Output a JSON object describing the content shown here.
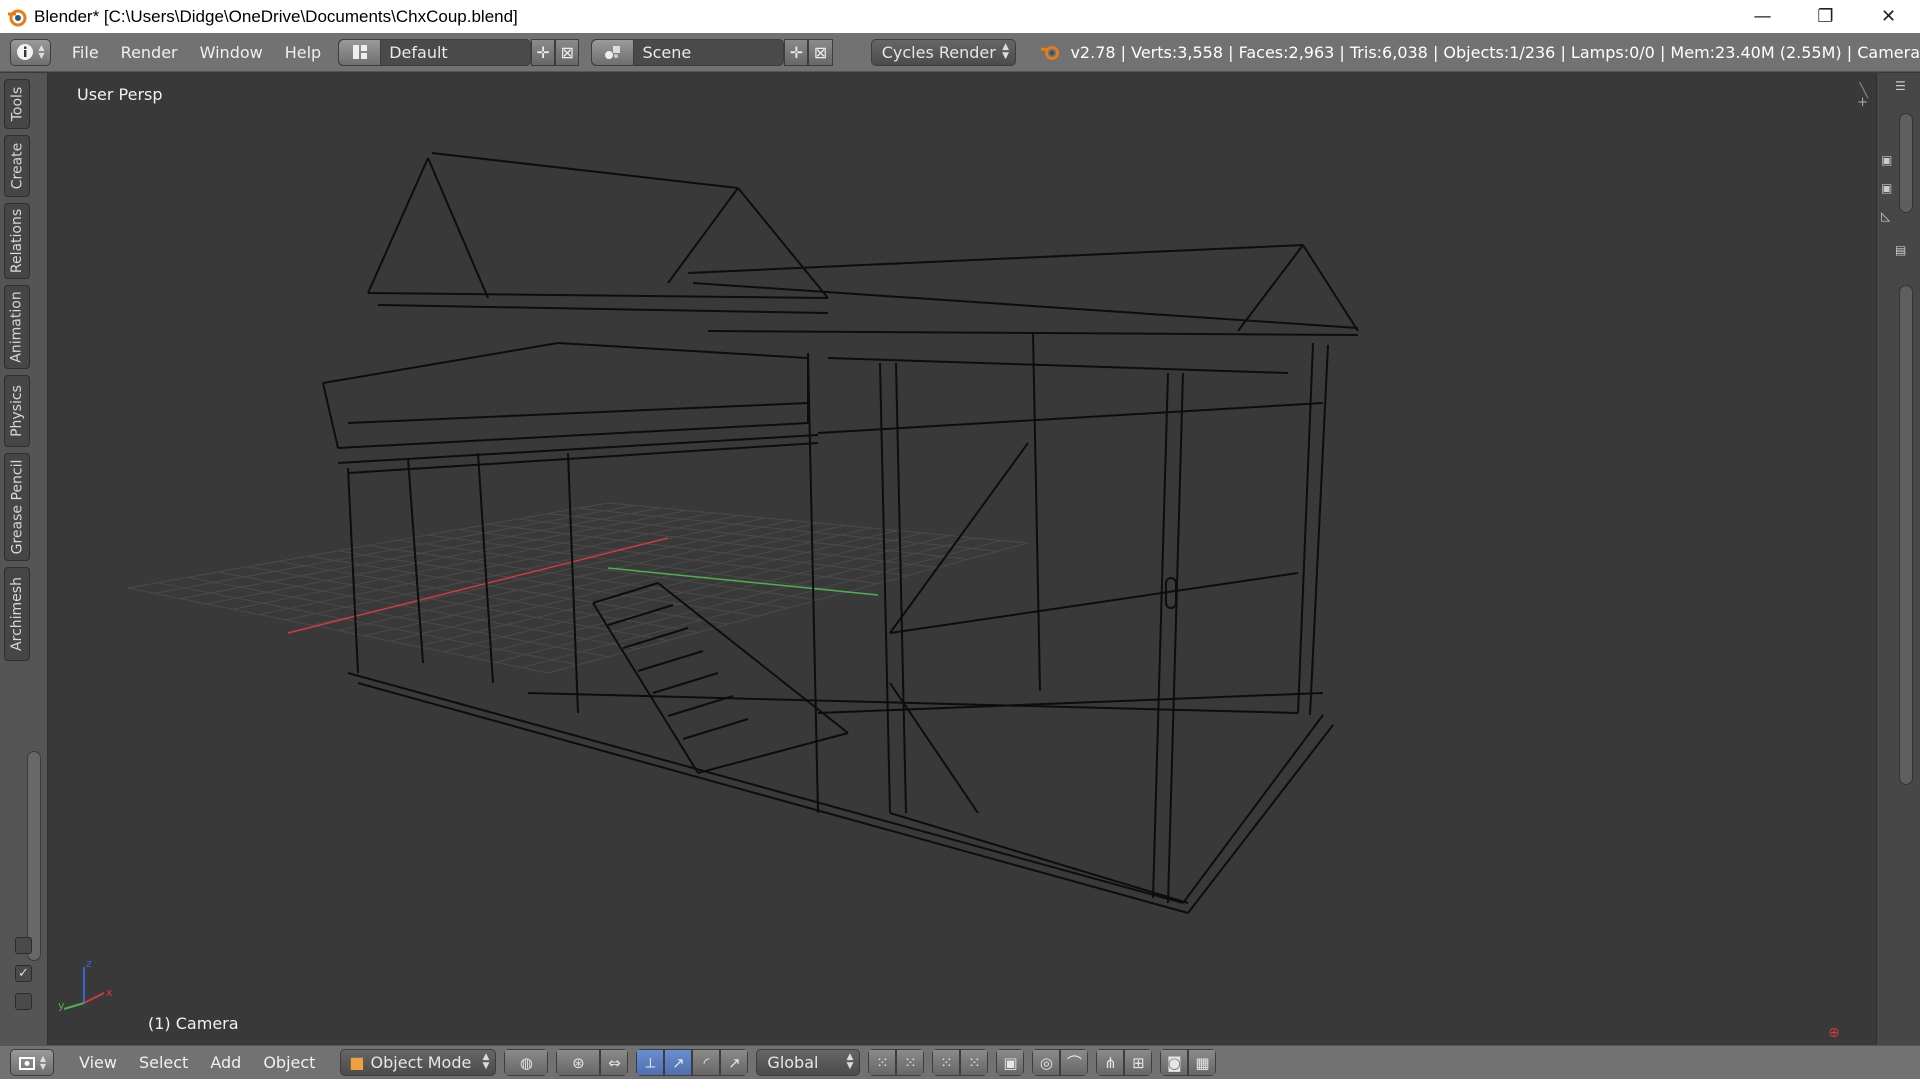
{
  "window": {
    "title": "Blender* [C:\\Users\\Didge\\OneDrive\\Documents\\ChxCoup.blend]",
    "minimize_glyph": "—",
    "maximize_glyph": "❐",
    "close_glyph": "✕"
  },
  "info_header": {
    "menus": [
      "File",
      "Render",
      "Window",
      "Help"
    ],
    "screen_layout": "Default",
    "scene": "Scene",
    "render_engine": "Cycles Render",
    "stats": "v2.78 | Verts:3,558 | Faces:2,963 | Tris:6,038 | Objects:1/236 | Lamps:0/0 | Mem:23.40M (2.55M) | Camera"
  },
  "tool_shelf": {
    "tabs": [
      "Tools",
      "Create",
      "Relations",
      "Animation",
      "Physics",
      "Grease Pencil",
      "Archimesh"
    ]
  },
  "viewport": {
    "view_name": "User Persp",
    "active_object": "(1) Camera",
    "axis_labels": {
      "x": "x",
      "y": "y",
      "z": "z"
    },
    "colors": {
      "x_axis": "#d33a3a",
      "y_axis": "#4fb04f",
      "z_axis": "#4060d8",
      "wire": "#0d0d0d",
      "grid": "#4a4a4a",
      "background": "#393939"
    }
  },
  "bottom_header": {
    "menus": [
      "View",
      "Select",
      "Add",
      "Object"
    ],
    "mode": "Object Mode",
    "transform_orientation": "Global"
  }
}
